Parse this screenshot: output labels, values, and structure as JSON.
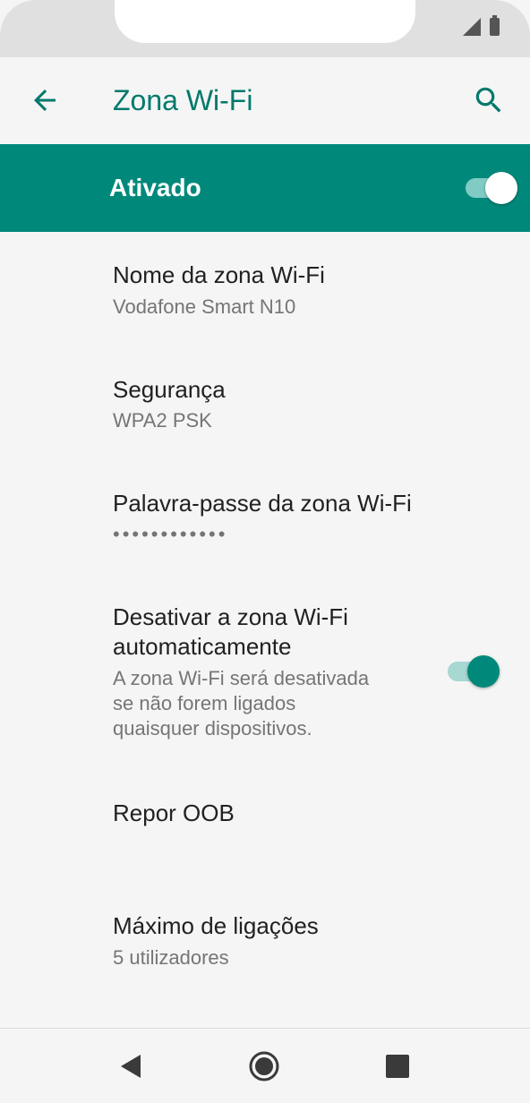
{
  "status_bar": {
    "icons": [
      "signal-icon",
      "battery-icon"
    ]
  },
  "app_bar": {
    "title": "Zona Wi-Fi",
    "back_icon": "arrow-back-icon",
    "search_icon": "search-icon"
  },
  "master_switch": {
    "label": "Ativado",
    "state": "on"
  },
  "settings": {
    "hotspot_name": {
      "title": "Nome da zona Wi-Fi",
      "value": "Vodafone Smart N10"
    },
    "security": {
      "title": "Segurança",
      "value": "WPA2 PSK"
    },
    "password": {
      "title": "Palavra-passe da zona Wi-Fi",
      "value": "••••••••••••"
    },
    "auto_off": {
      "title_line1": "Desativar a zona Wi-Fi",
      "title_line2": "automaticamente",
      "desc_line1": "A zona Wi-Fi será desativada",
      "desc_line2": "se não forem ligados",
      "desc_line3": "quaisquer dispositivos.",
      "state": "on"
    },
    "reset": {
      "title": "Repor OOB"
    },
    "max_connections": {
      "title": "Máximo de ligações",
      "value": "5 utilizadores"
    }
  },
  "colors": {
    "accent": "#00796b",
    "bar": "#00897b",
    "background": "#f5f5f5"
  },
  "nav_bar": {
    "icons": [
      "nav-back-icon",
      "nav-home-icon",
      "nav-recents-icon"
    ]
  }
}
